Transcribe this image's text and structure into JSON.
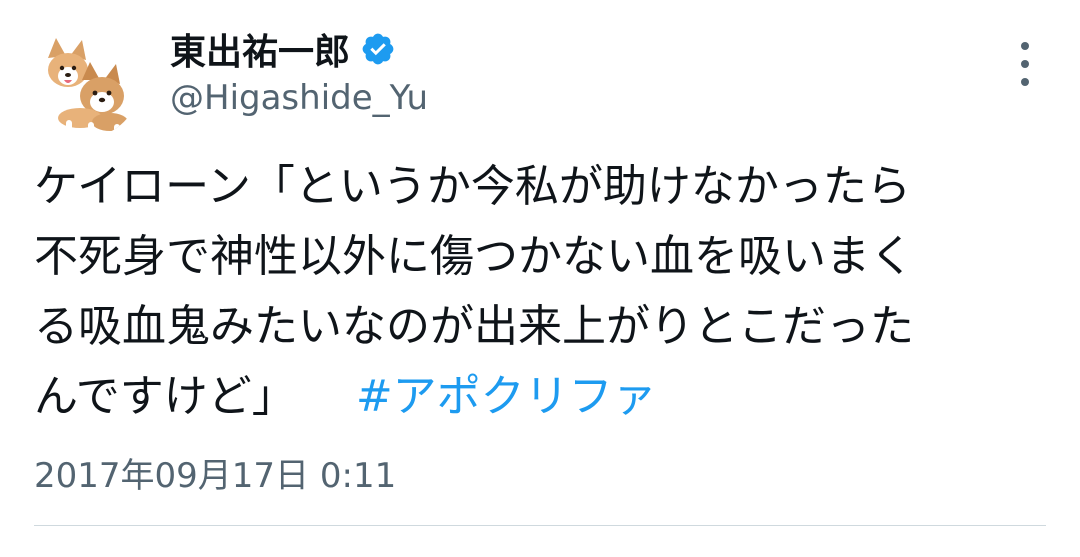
{
  "author": {
    "display_name": "東出祐一郎",
    "handle": "@Higashide_Yu",
    "verified_icon": "verified-badge-icon",
    "avatar_icon": "corgi-dogs-avatar"
  },
  "menu": {
    "icon": "more-options-icon"
  },
  "tweet": {
    "lines": [
      "ケイローン「というか今私が助けなかったら",
      "不死身で神性以外に傷つかない血を吸いまく",
      "る吸血鬼みたいなのが出来上がりとこだった",
      "んですけど」"
    ],
    "hashtag": "#アポクリファ",
    "timestamp": "2017年09月17日 0:11"
  },
  "colors": {
    "text": "#0f1419",
    "secondary": "#536471",
    "link": "#1d9bf0",
    "verified": "#1d9bf0",
    "divider": "#cfd9de"
  }
}
